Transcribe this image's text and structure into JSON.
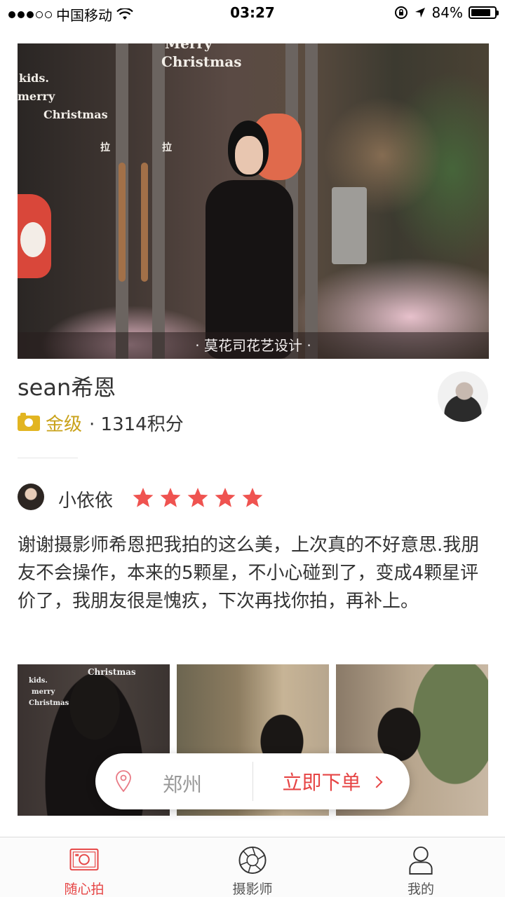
{
  "status_bar": {
    "carrier": "中国移动",
    "time": "03:27",
    "battery_percent": "84%",
    "battery_level": 0.84
  },
  "hero": {
    "caption": "· 莫花司花艺设计 ·",
    "overlay_text": [
      "Merry",
      "Christmas",
      "kids.",
      "merry",
      "Christmas",
      "拉",
      "拉"
    ]
  },
  "photographer": {
    "name": "sean希恩",
    "level": "金级",
    "score": "· 1314积分"
  },
  "review": {
    "reviewer": "小依依",
    "rating": 5,
    "text": "谢谢摄影师希恩把我拍的这么美，上次真的不好意思.我朋友不会操作，本来的5颗星，不小心碰到了，变成4颗星评价了，我朋友很是愧疚，下次再找你拍，再补上。"
  },
  "thumbnails": {
    "labels": [
      "Christmas",
      "kids.",
      "merry",
      "Christmas"
    ]
  },
  "order_bar": {
    "city": "郑州",
    "button_label": "立即下单"
  },
  "tabs": [
    {
      "label": "随心拍",
      "icon": "camera-icon",
      "active": true
    },
    {
      "label": "摄影师",
      "icon": "aperture-icon",
      "active": false
    },
    {
      "label": "我的",
      "icon": "user-icon",
      "active": false
    }
  ],
  "colors": {
    "accent": "#e64545",
    "gold": "#c9a21a",
    "star": "#ef5350"
  }
}
